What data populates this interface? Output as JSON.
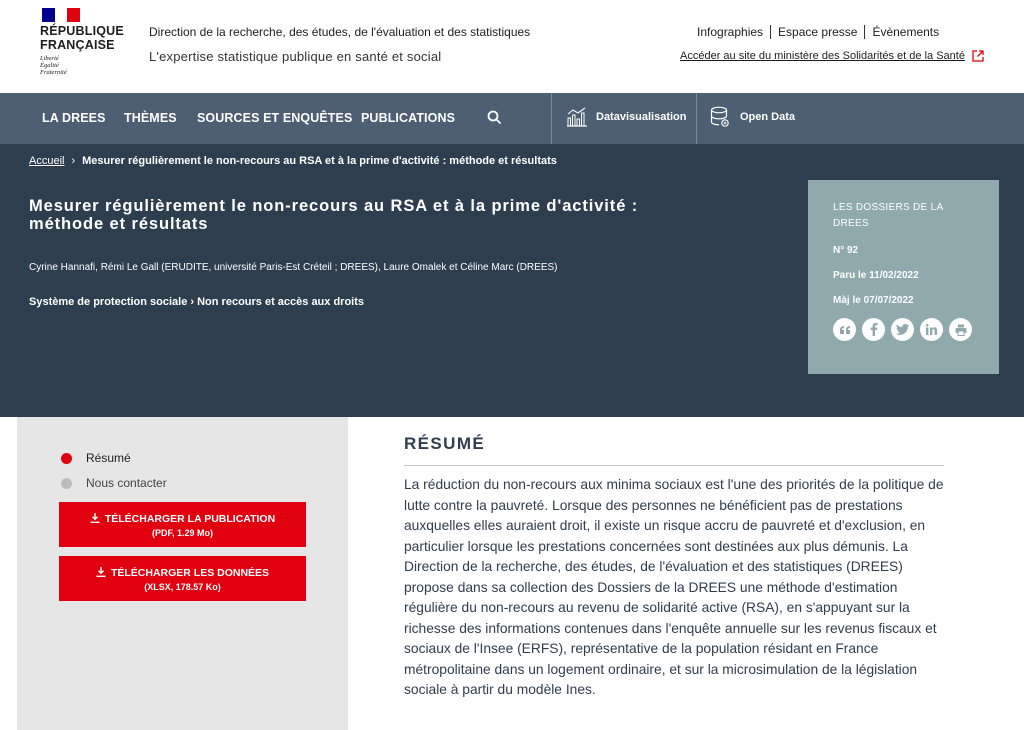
{
  "header": {
    "republic_line1": "RÉPUBLIQUE",
    "republic_line2": "FRANÇAISE",
    "motto": [
      "Liberté",
      "Égalité",
      "Fraternité"
    ],
    "org_title": "Direction de la recherche, des études, de l'évaluation et des statistiques",
    "org_subtitle": "L'expertise statistique publique en santé et social",
    "top_links": [
      "Infographies",
      "Espace presse",
      "Évènements"
    ],
    "ministry_link": "Accéder au site du ministère des Solidarités et de la Santé",
    "flag_colors": [
      "#000091",
      "#ffffff",
      "#e1000f"
    ]
  },
  "nav": {
    "items": [
      "LA DREES",
      "THÈMES",
      "SOURCES ET ENQUÊTES",
      "PUBLICATIONS"
    ],
    "datavis": "Datavisualisation",
    "open_data": "Open Data"
  },
  "hero": {
    "breadcrumb_home": "Accueil",
    "breadcrumb_current": "Mesurer régulièrement le non-recours au RSA et à la prime d'activité : méthode et résultats",
    "title": "Mesurer régulièrement le non-recours au RSA et à la prime d'activité : méthode et résultats",
    "authors": "Cyrine Hannafi, Rémi Le Gall (ERUDITE, université Paris-Est Créteil ; DREES), Laure Omalek et Céline Marc (DREES)",
    "themes": "Système de protection sociale › Non recours et accès aux droits",
    "card": {
      "collection": "LES DOSSIERS DE LA DREES",
      "number": "N° 92",
      "published": "Paru le 11/02/2022",
      "updated": "Màj le 07/07/2022"
    }
  },
  "sidebar": {
    "items": [
      "Résumé",
      "Nous contacter"
    ],
    "download_pub": {
      "label": "TÉLÉCHARGER LA PUBLICATION",
      "sub": "(PDF, 1.29 Mo)"
    },
    "download_data": {
      "label": "TÉLÉCHARGER LES DONNÉES",
      "sub": "(XLSX, 178.57 Ko)"
    }
  },
  "main": {
    "section_title": "RÉSUMÉ",
    "abstract": "La réduction du non-recours aux minima sociaux est l'une des priorités de la politique de lutte contre la pauvreté. Lorsque des personnes ne bénéficient pas de prestations auxquelles elles auraient droit, il existe un risque accru de pauvreté et d'exclusion, en particulier lorsque les prestations concernées sont destinées aux plus démunis. La Direction de la recherche, des études, de l'évaluation et des statistiques (DREES) propose dans sa collection des Dossiers de la DREES une méthode d'estimation régulière du non-recours au revenu de solidarité active (RSA), en s'appuyant sur la richesse des informations contenues dans l'enquête annuelle sur les revenus fiscaux et sociaux de l'Insee (ERFS), représentative de la population résidant en France métropolitaine dans un logement ordinaire, et sur la microsimulation de la législation sociale à partir du modèle Ines."
  }
}
